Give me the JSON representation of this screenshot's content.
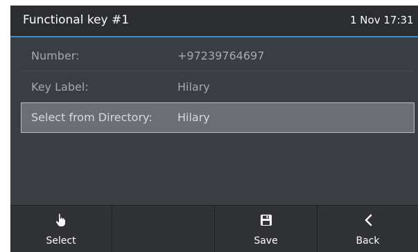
{
  "header": {
    "title": "Functional key #1",
    "clock": "1 Nov 17:31"
  },
  "fields": [
    {
      "label": "Number:",
      "value": "+97239764697"
    },
    {
      "label": "Key Label:",
      "value": "Hilary"
    },
    {
      "label": "Select from Directory:",
      "value": "Hilary"
    }
  ],
  "selected_field_index": 2,
  "softkeys": [
    {
      "label": "Select",
      "icon": "hand-pointer-icon"
    },
    {
      "label": "",
      "icon": ""
    },
    {
      "label": "Save",
      "icon": "floppy-disk-icon"
    },
    {
      "label": "Back",
      "icon": "chevron-left-icon"
    }
  ],
  "colors": {
    "accent": "#3d8fd1",
    "background": "#3b3d42",
    "selected_row": "#6b6f75"
  }
}
